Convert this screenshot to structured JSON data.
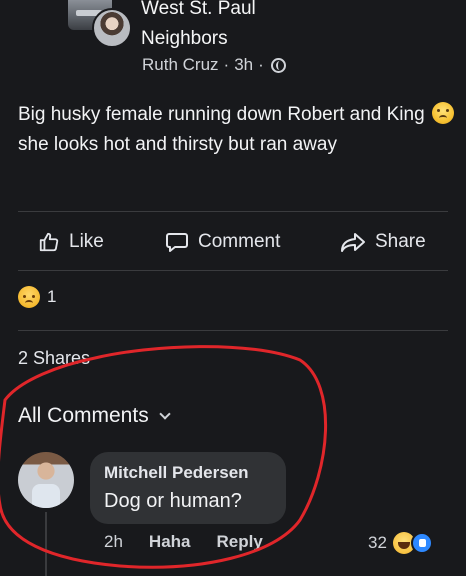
{
  "post": {
    "group_name_line1": "West St. Paul",
    "group_name_line2": "Neighbors",
    "author": "Ruth Cruz",
    "separator": "·",
    "time": "3h",
    "visibility_icon": "globe-icon",
    "text_part1": "Big husky female running down Robert and King ",
    "text_part2": "she looks hot and thirsty but ran away",
    "inline_emoji": "sweating-face-emoji"
  },
  "actions": {
    "like_label": "Like",
    "comment_label": "Comment",
    "share_label": "Share"
  },
  "reactions": {
    "icon": "sad-reaction-icon",
    "count": "1"
  },
  "shares_label": "2 Shares",
  "comments": {
    "filter_label": "All Comments",
    "items": [
      {
        "author": "Mitchell Pedersen",
        "text": "Dog or human?",
        "time": "2h",
        "reaction_label": "Haha",
        "reply_label": "Reply",
        "reaction_count": "32"
      }
    ]
  },
  "annotation_color": "#e0262a",
  "accent_colors": {
    "background": "#18191c",
    "bubble": "#303235",
    "text": "#e4e6eb"
  }
}
